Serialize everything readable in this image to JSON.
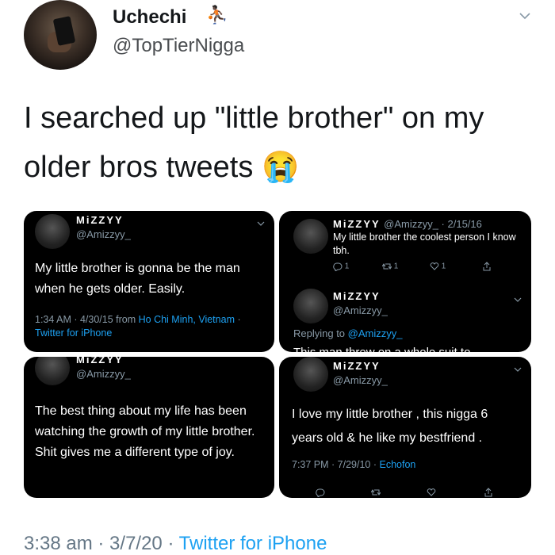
{
  "author": {
    "display_name": "Uchechi",
    "name_emoji": "⛹🏿",
    "handle": "@TopTierNigga"
  },
  "tweet": {
    "text": "I searched up \"little brother\" on my older bros tweets",
    "emoji": "😭"
  },
  "embedded": {
    "tl": {
      "name": "MiZZYY",
      "handle": "@Amizzyy_",
      "body": "My little brother is gonna be the man when he gets older. Easily.",
      "time_date": "1:34 AM · 4/30/15 from ",
      "location": "Ho Chi Minh, Vietnam",
      "sep": " ·",
      "client": "Twitter for iPhone"
    },
    "tr": {
      "name": "MiZZYY",
      "handle_date": "@Amizzyy_ · 2/15/16",
      "body": "My little brother the coolest person I know tbh.",
      "replies": "1",
      "retweets": "1",
      "likes": "1",
      "name2": "MiZZYY",
      "handle2": "@Amizzyy_",
      "replying_label": "Replying to ",
      "replying_handle": "@Amizzyy_",
      "cut_text": "This man threw on a whole suit to"
    },
    "bl": {
      "name": "MiZZYY",
      "handle": "@Amizzyy_",
      "body": "The best thing about my life has been watching the growth of my little brother. Shit gives me a different type of joy."
    },
    "br": {
      "name": "MiZZYY",
      "handle": "@Amizzyy_",
      "body": "I love my little brother , this nigga 6 years old & he like my bestfriend .",
      "time_date": "7:37 PM · 7/29/10 · ",
      "client": "Echofon"
    }
  },
  "footer": {
    "time_date": "3:38 am · 3/7/20 · ",
    "client": "Twitter for iPhone"
  }
}
